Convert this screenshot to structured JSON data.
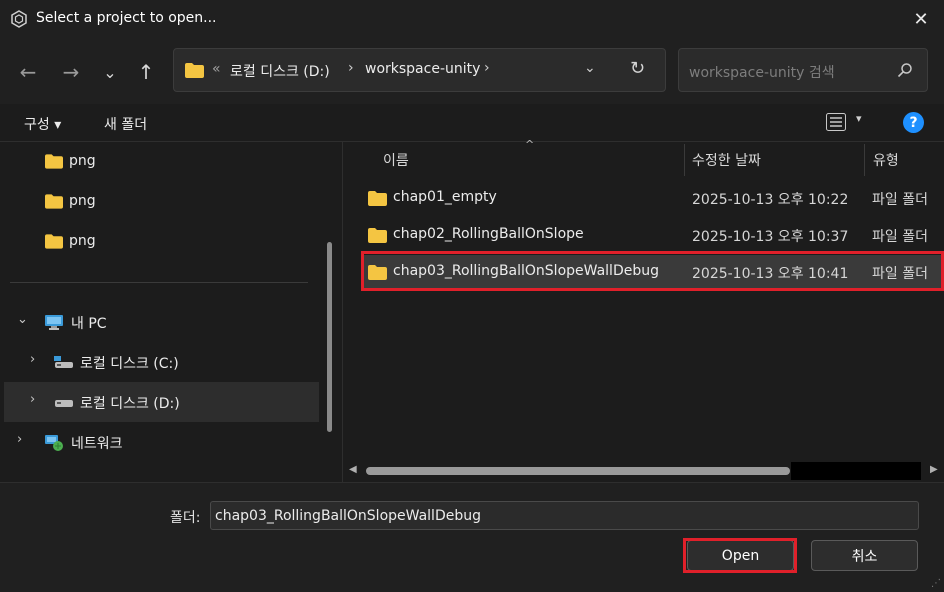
{
  "window": {
    "title": "Select a project to open...",
    "close_glyph": "✕"
  },
  "nav": {
    "back_glyph": "←",
    "forward_glyph": "→",
    "recent_glyph": "⌄",
    "up_glyph": "↑",
    "address": {
      "overflow": "«",
      "segments": [
        "로컬 디스크 (D:)",
        "workspace-unity"
      ],
      "separator": "›",
      "dropdown_glyph": "⌄",
      "refresh_glyph": "↻"
    },
    "search": {
      "placeholder": "workspace-unity 검색"
    }
  },
  "toolbar": {
    "organize_label": "구성 ▾",
    "new_folder_label": "새 폴더",
    "view_dd": "▾",
    "help_label": "?"
  },
  "sidebar": {
    "items": [
      {
        "label": "png",
        "icon": "folder-icon"
      },
      {
        "label": "png",
        "icon": "folder-icon"
      },
      {
        "label": "png",
        "icon": "folder-icon"
      },
      {
        "label": "내 PC",
        "icon": "pc-icon",
        "chevron": "⌄"
      },
      {
        "label": "로컬 디스크 (C:)",
        "icon": "drive-icon",
        "chevron": "›"
      },
      {
        "label": "로컬 디스크 (D:)",
        "icon": "drive-icon",
        "chevron": "›",
        "selected": true
      },
      {
        "label": "네트워크",
        "icon": "network-icon",
        "chevron": "›"
      }
    ]
  },
  "files": {
    "columns": {
      "name": "이름",
      "date": "수정한 날짜",
      "type": "유형",
      "sort_glyph": "^"
    },
    "rows": [
      {
        "name": "chap01_empty",
        "date": "2025-10-13 오후 10:22",
        "type": "파일 폴더"
      },
      {
        "name": "chap02_RollingBallOnSlope",
        "date": "2025-10-13 오후 10:37",
        "type": "파일 폴더"
      },
      {
        "name": "chap03_RollingBallOnSlopeWallDebug",
        "date": "2025-10-13 오후 10:41",
        "type": "파일 폴더",
        "selected": true
      }
    ],
    "scroll_left": "◀",
    "scroll_right": "▶"
  },
  "bottom": {
    "folder_label": "폴더:",
    "folder_value": "chap03_RollingBallOnSlopeWallDebug",
    "open_label": "Open",
    "cancel_label": "취소",
    "grip_glyph": "⋰"
  },
  "colors": {
    "background": "#1c1c1c",
    "highlight": "#e0202a",
    "folder": "#f4c542",
    "accent": "#1e90ff"
  }
}
